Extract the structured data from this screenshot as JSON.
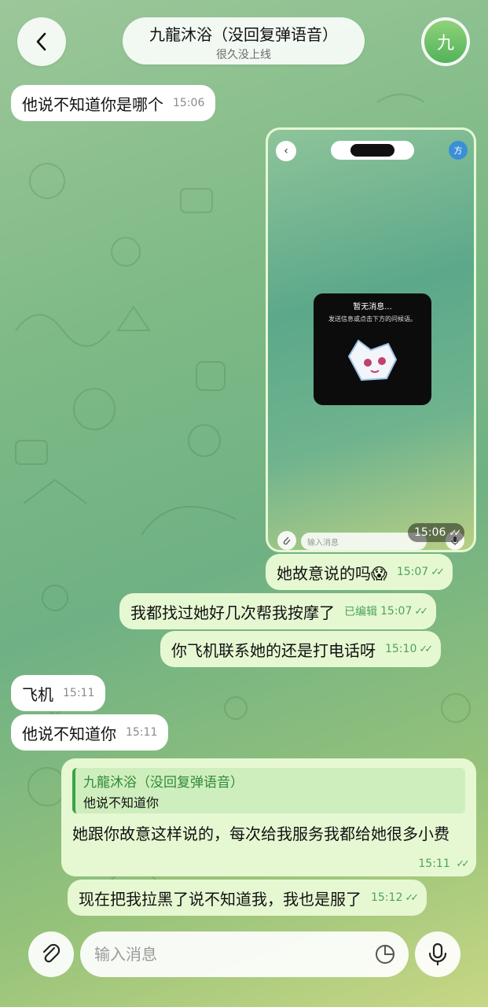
{
  "header": {
    "back_label": "back",
    "title": "九龍沐浴（没回复弹语音）",
    "status": "很久没上线",
    "avatar_initial": "九"
  },
  "messages": [
    {
      "dir": "in",
      "text": "他说不知道你是哪个",
      "time": "15:06"
    },
    {
      "dir": "out",
      "type": "image",
      "time": "15:06",
      "screenshot": {
        "avatar_initial": "方",
        "empty_title": "暂无消息...",
        "empty_sub": "发送信息或点击下方的问候语。",
        "input_placeholder": "输入消息"
      }
    },
    {
      "dir": "out",
      "text": "她故意说的吗😱",
      "time": "15:07"
    },
    {
      "dir": "out",
      "text": "我都找过她好几次帮我按摩了",
      "edited": "已编辑",
      "time": "15:07"
    },
    {
      "dir": "out",
      "text": "你飞机联系她的还是打电话呀",
      "time": "15:10"
    },
    {
      "dir": "in",
      "text": "飞机",
      "time": "15:11"
    },
    {
      "dir": "in",
      "text": "他说不知道你",
      "time": "15:11"
    },
    {
      "dir": "out",
      "type": "reply",
      "quote_name": "九龍沐浴（没回复弹语音）",
      "quote_text": "他说不知道你",
      "text": "她跟你故意这样说的，每次给我服务我都给她很多小费",
      "time": "15:11"
    },
    {
      "dir": "out",
      "text": "现在把我拉黑了说不知道我，我也是服了",
      "time": "15:12"
    }
  ],
  "composer": {
    "placeholder": "输入消息"
  },
  "icons": {
    "back": "chevron-left-icon",
    "attach": "paperclip-icon",
    "sticker": "sticker-icon",
    "mic": "microphone-icon",
    "read": "double-check-icon"
  },
  "colors": {
    "incoming_bubble": "#ffffff",
    "outgoing_bubble": "#e6f8d2",
    "accent_green": "#4da35a"
  }
}
